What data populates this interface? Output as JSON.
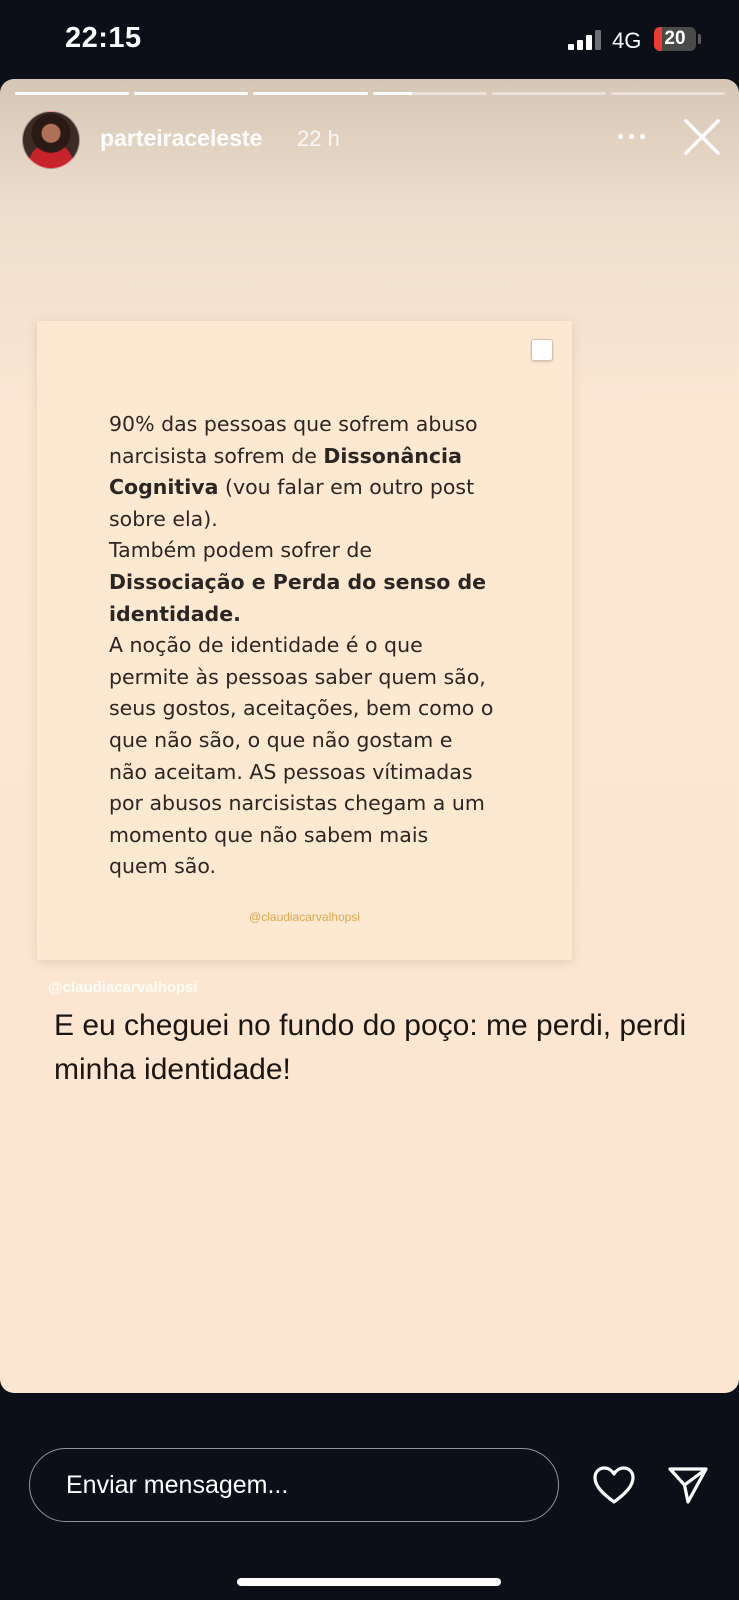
{
  "status_bar": {
    "time": "22:15",
    "network": "4G",
    "battery": "20",
    "battery_level": 0.2
  },
  "story": {
    "segments": 6,
    "active_segment": 3,
    "active_segment_progress": 0.35,
    "username": "parteiraceleste",
    "time_ago": "22 h",
    "icons": [
      "more-icon",
      "close-icon"
    ]
  },
  "post": {
    "lines": [
      "90% das pessoas que sofrem abuso",
      "narcisista sofrem de ",
      "Dissonância",
      "Cognitiva",
      " (vou falar em outro post",
      "sobre ela).",
      "Também podem sofrer de",
      "Dissociação e Perda do senso de",
      "identidade.",
      "A noção de identidade é o que",
      "permite às pessoas saber quem são,",
      "seus gostos, aceitações, bem como o",
      "que não são, o que não gostam e",
      "não aceitam. AS pessoas vítimadas",
      "por abusos narcisistas chegam a um",
      "momento que não sabem mais",
      "quem são."
    ],
    "credit": "@claudiacarvalhopsi"
  },
  "mention": "@claudiacarvalhopsi",
  "caption": "E eu cheguei no fundo do poço: me perdi, perdi minha identidade!",
  "bottom": {
    "message_placeholder": "Enviar mensagem...",
    "icons": [
      "heart-icon",
      "send-icon"
    ]
  },
  "colors": {
    "background": "#0c0f18",
    "story_bg": "#fce6d1",
    "credit": "#d9a94c",
    "battery_low": "#ee3b2f"
  }
}
